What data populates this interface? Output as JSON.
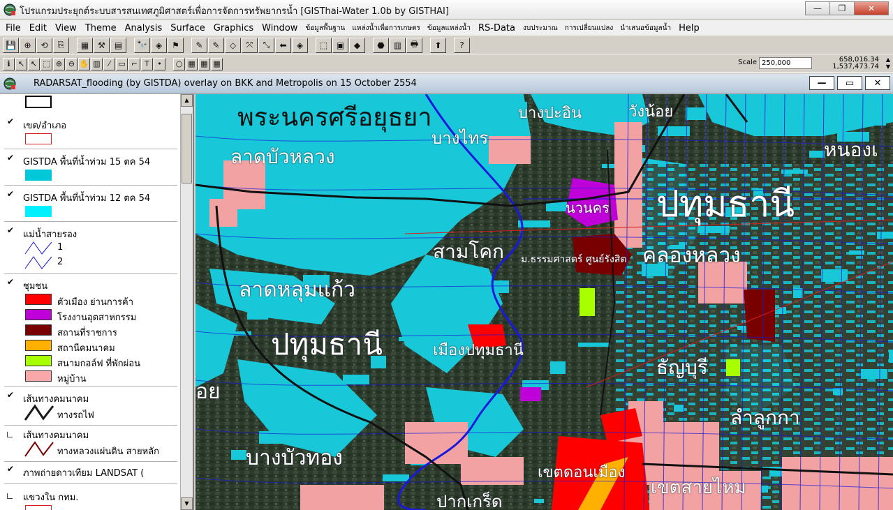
{
  "window": {
    "title": "โปรแกรมประยุกต์ระบบสารสนเทศภูมิศาสตร์เพื่อการจัดการทรัพยากรน้ำ  [GISThai-Water 1.0b   by GISTHAI]",
    "minimize_glyph": "—",
    "maximize_glyph": "❐",
    "close_glyph": "✕"
  },
  "menu": [
    {
      "label": "File",
      "thai": false
    },
    {
      "label": "Edit",
      "thai": false
    },
    {
      "label": "View",
      "thai": false
    },
    {
      "label": "Theme",
      "thai": false
    },
    {
      "label": "Analysis",
      "thai": false
    },
    {
      "label": "Surface",
      "thai": false
    },
    {
      "label": "Graphics",
      "thai": false
    },
    {
      "label": "Window",
      "thai": false
    },
    {
      "label": "ข้อมูลพื้นฐาน",
      "thai": true
    },
    {
      "label": "แหล่งน้ำเพื่อการเกษตร",
      "thai": true
    },
    {
      "label": "ข้อมูลแหล่งน้ำ",
      "thai": true
    },
    {
      "label": "RS-Data",
      "thai": false
    },
    {
      "label": "งบประมาณ",
      "thai": true
    },
    {
      "label": "การเปลี่ยนแปลง",
      "thai": true
    },
    {
      "label": "นำเสนอข้อมูลน้ำ",
      "thai": true
    },
    {
      "label": "Help",
      "thai": false
    }
  ],
  "toolbar1": [
    "💾",
    "⊕",
    "⟲",
    "⎘",
    "gap",
    "▦",
    "⚒",
    "▤",
    "gap",
    "🔭",
    "◈",
    "⚑",
    "gap",
    "✎",
    "✎",
    "◇",
    "⤧",
    "⤡",
    "⬅",
    "◈",
    "gap",
    "⬚",
    "▣",
    "◆",
    "gap",
    "⬣",
    "▥",
    "🖶",
    "gap",
    "⬆",
    "gap",
    "?"
  ],
  "toolbar2": [
    "ℹ",
    "↖",
    "↖",
    "⬚",
    "⊕",
    "⊖",
    "✋",
    "▥",
    "⁄",
    "▭",
    "⌐",
    "T",
    "•",
    "gap",
    "○",
    "▦",
    "▦",
    "▦"
  ],
  "scale": {
    "label": "Scale 1:",
    "value": "250,000"
  },
  "coords": {
    "x": "658,016.34",
    "y": "1,537,473.74",
    "up_glyph": "▲",
    "down_glyph": "▼"
  },
  "view": {
    "title": "RADARSAT_flooding (by GISTDA) overlay on BKK and Metropolis on 15 October 2554",
    "min_glyph": "—",
    "max_glyph": "▭",
    "close_glyph": "✕"
  },
  "toc": {
    "check_glyph": "✔",
    "themes": [
      {
        "id": "district",
        "name": "เขต/อำเภอ",
        "checked": true
      },
      {
        "id": "flood15",
        "name": "GISTDA พื้นที่น้ำท่วม 15 ตค 54",
        "checked": true
      },
      {
        "id": "flood12",
        "name": "GISTDA พื้นที่น้ำท่วม 12 ตค 54",
        "checked": true
      },
      {
        "id": "river",
        "name": "แม่น้ำสายรอง",
        "checked": true,
        "classes": [
          "1",
          "2"
        ]
      },
      {
        "id": "community",
        "name": "ชุมชน",
        "checked": true,
        "classes": [
          "ตัวเมือง ย่านการค้า",
          "โรงงานอุตสาหกรรม",
          "สถานที่ราชการ",
          "สถานีคมนาคม",
          "สนามกอล์ฟ ที่พักผ่อน",
          "หมู่บ้าน"
        ]
      },
      {
        "id": "rail",
        "name": "เส้นทางคมนาคม",
        "checked": true,
        "classes": [
          "ทางรถไฟ"
        ]
      },
      {
        "id": "road",
        "name": "เส้นทางคมนาคม",
        "checked": false,
        "classes": [
          "ทางหลวงแผ่นดิน สายหลัก"
        ]
      },
      {
        "id": "landsat",
        "name": "ภาพถ่ายดาวเทียม LANDSAT  (",
        "checked": true
      },
      {
        "id": "khwaeng",
        "name": "แขวงใน กทม.",
        "checked": false
      }
    ],
    "colors": {
      "district": "#d61f1f",
      "flood15": "#00c8d8",
      "flood12": "#00f0ff",
      "river": "#1a1adc",
      "community": [
        "#ff0000",
        "#c000d8",
        "#780000",
        "#ffb000",
        "#a8ff00",
        "#f8a8a8"
      ],
      "rail": "#1a1a1a",
      "road": "#7a0000"
    }
  },
  "map": {
    "flood_color": "#18c8d8",
    "village_color": "#f2a2a2",
    "labels": [
      {
        "id": "ayutthaya",
        "text": "พระนครศรีอยุธยา"
      },
      {
        "id": "bangpain",
        "text": "บางปะอิน"
      },
      {
        "id": "wangnoi",
        "text": "วังน้อย"
      },
      {
        "id": "bangsai",
        "text": "บางไทร"
      },
      {
        "id": "nongsua",
        "text": "หนองเ"
      },
      {
        "id": "latbualuang",
        "text": "ลาดบัวหลวง"
      },
      {
        "id": "pathum_big",
        "text": "ปทุมธานี"
      },
      {
        "id": "nawanakorn",
        "text": "นวนคร"
      },
      {
        "id": "samkhok",
        "text": "สามโคก"
      },
      {
        "id": "thammasat",
        "text": "ม.ธรรมศาสตร์ ศูนย์รังสิต"
      },
      {
        "id": "khlongluang",
        "text": "คลองหลวง"
      },
      {
        "id": "latlumkaeo",
        "text": "ลาดหลุมแก้ว"
      },
      {
        "id": "pathum_mid",
        "text": "ปทุมธานี"
      },
      {
        "id": "muangpathum",
        "text": "เมืองปทุมธานี"
      },
      {
        "id": "thanyaburi",
        "text": "ธัญบุรี"
      },
      {
        "id": "sainoi",
        "text": "้อย"
      },
      {
        "id": "lamlukka",
        "text": "ลำลูกกา"
      },
      {
        "id": "bangbuathong",
        "text": "บางบัวทอง"
      },
      {
        "id": "donmuang",
        "text": "เขตดอนเมือง"
      },
      {
        "id": "saimai",
        "text": "เขตสายไหม"
      },
      {
        "id": "pakkret",
        "text": "ปากเกร็ด"
      }
    ]
  }
}
